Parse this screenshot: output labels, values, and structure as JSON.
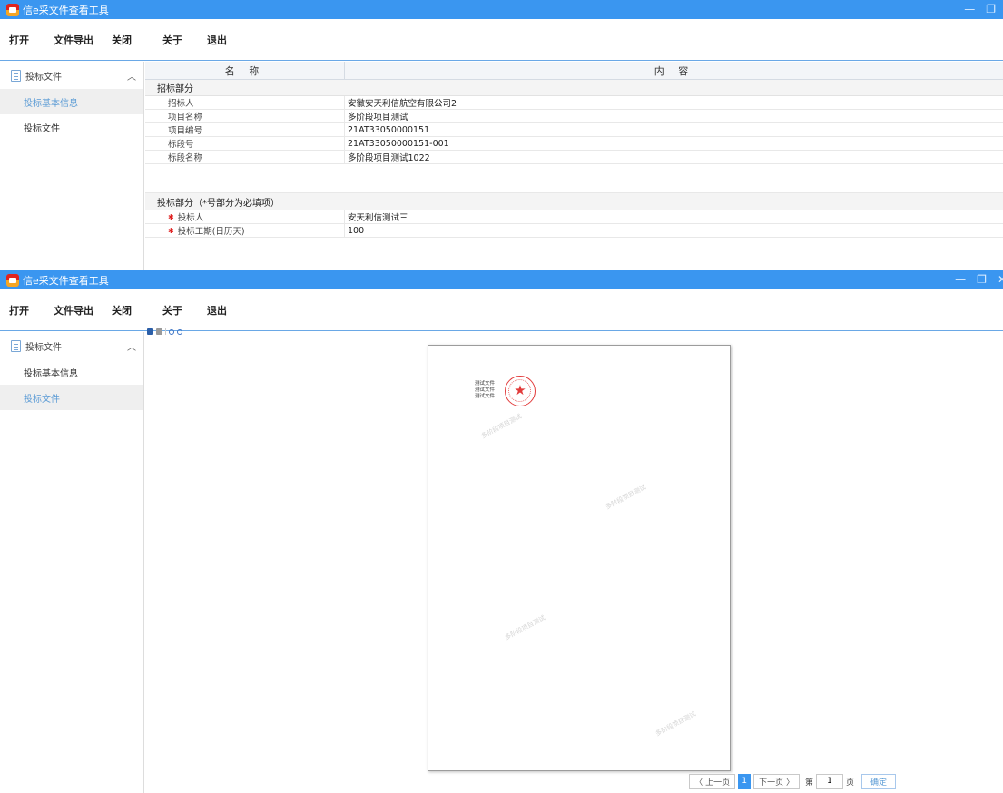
{
  "app": {
    "title": "信e采文件查看工具",
    "minimize_glyph": "—",
    "restore_glyph": "❐",
    "close_glyph": "✕"
  },
  "menu": [
    "打开",
    "文件导出",
    "关闭",
    "关于",
    "退出"
  ],
  "sidebar": {
    "header": "投标文件",
    "collapse_glyph": "︿",
    "items": [
      "投标基本信息",
      "投标文件"
    ]
  },
  "table": {
    "col_name": "名 称",
    "col_content": "内 容",
    "tender_section": "招标部分",
    "tender_rows": [
      {
        "name": "招标人",
        "value": "安徽安天利信航空有限公司2"
      },
      {
        "name": "项目名称",
        "value": "多阶段项目测试"
      },
      {
        "name": "项目编号",
        "value": "21AT33050000151"
      },
      {
        "name": "标段号",
        "value": "21AT33050000151-001"
      },
      {
        "name": "标段名称",
        "value": "多阶段项目测试1022"
      }
    ],
    "bid_section": "投标部分（*号部分为必填项）",
    "bid_rows": [
      {
        "name": "投标人",
        "value": "安天利信测试三",
        "required": true
      },
      {
        "name": "投标工期(日历天)",
        "value": "100",
        "required": true
      }
    ],
    "required_mark": "✱"
  },
  "viewer": {
    "doc_lines": [
      "测试文件",
      "测试文件",
      "测试文件"
    ],
    "watermark": "多阶段项目测试",
    "seal_glyph": "★",
    "pager": {
      "prev": "〈 上一页",
      "current": "1",
      "next": "下一页 〉",
      "goto_prefix": "第",
      "page_value": "1",
      "goto_suffix": "页",
      "confirm": "确定"
    }
  },
  "colors": {
    "titlebar": "#3a96f0",
    "active_item": "#5b9bd5",
    "required": "#e02020",
    "seal": "#e23b3b"
  }
}
